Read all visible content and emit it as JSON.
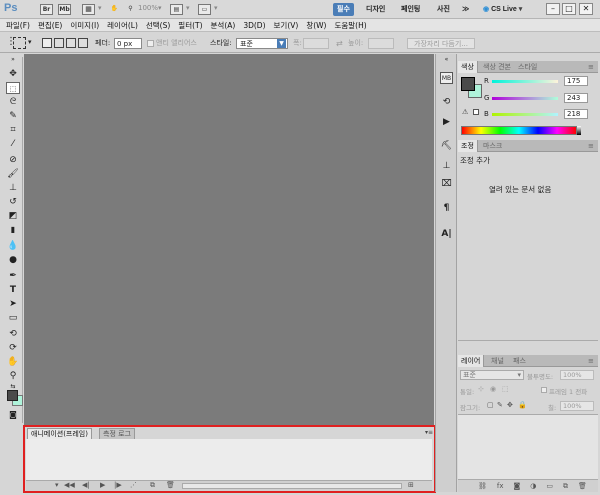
{
  "app": {
    "logo": "Ps",
    "bridge_icon": "Br",
    "mini_bridge_icon": "Mb",
    "zoom": "100%",
    "workspaces": [
      "필수",
      "디자인",
      "페인팅",
      "사진"
    ],
    "more": "≫",
    "cslive": "CS Live"
  },
  "menu": [
    "파일(F)",
    "편집(E)",
    "이미지(I)",
    "레이어(L)",
    "선택(S)",
    "필터(T)",
    "분석(A)",
    "3D(D)",
    "보기(V)",
    "창(W)",
    "도움말(H)"
  ],
  "options": {
    "feather_label": "페더:",
    "feather_value": "0 px",
    "antialias_label": "앤티 앨리어스",
    "style_label": "스타일:",
    "style_value": "표준",
    "width_label": "폭:",
    "height_label": "높이:",
    "refine_button": "가장자리 다듬기..."
  },
  "color_panel": {
    "tabs": [
      "색상",
      "색상 견본",
      "스타일"
    ],
    "r_label": "R",
    "g_label": "G",
    "b_label": "B",
    "r": 175,
    "g": 243,
    "b": 218,
    "foreground": "#4a4a4a",
    "background": "#aff3da"
  },
  "adjust_panel": {
    "tabs": [
      "조정",
      "마스크"
    ],
    "title": "조정 추가",
    "empty_text": "열려 있는 문서 없음"
  },
  "layers_panel": {
    "tabs": [
      "레이어",
      "채널",
      "패스"
    ],
    "blend_mode": "표준",
    "opacity_label": "불투명도:",
    "opacity_value": "100%",
    "unify_label": "통일:",
    "propagate_label": "프레임 1 전파",
    "lock_label": "잠그기:",
    "fill_label": "칠:",
    "fill_value": "100%"
  },
  "animation_panel": {
    "tabs": [
      "애니메이션(프레임)",
      "측정 로그"
    ]
  },
  "colors": {
    "accent": "#4a7db7",
    "highlight_border": "#e02020",
    "canvas_bg": "#7b7b7b"
  }
}
